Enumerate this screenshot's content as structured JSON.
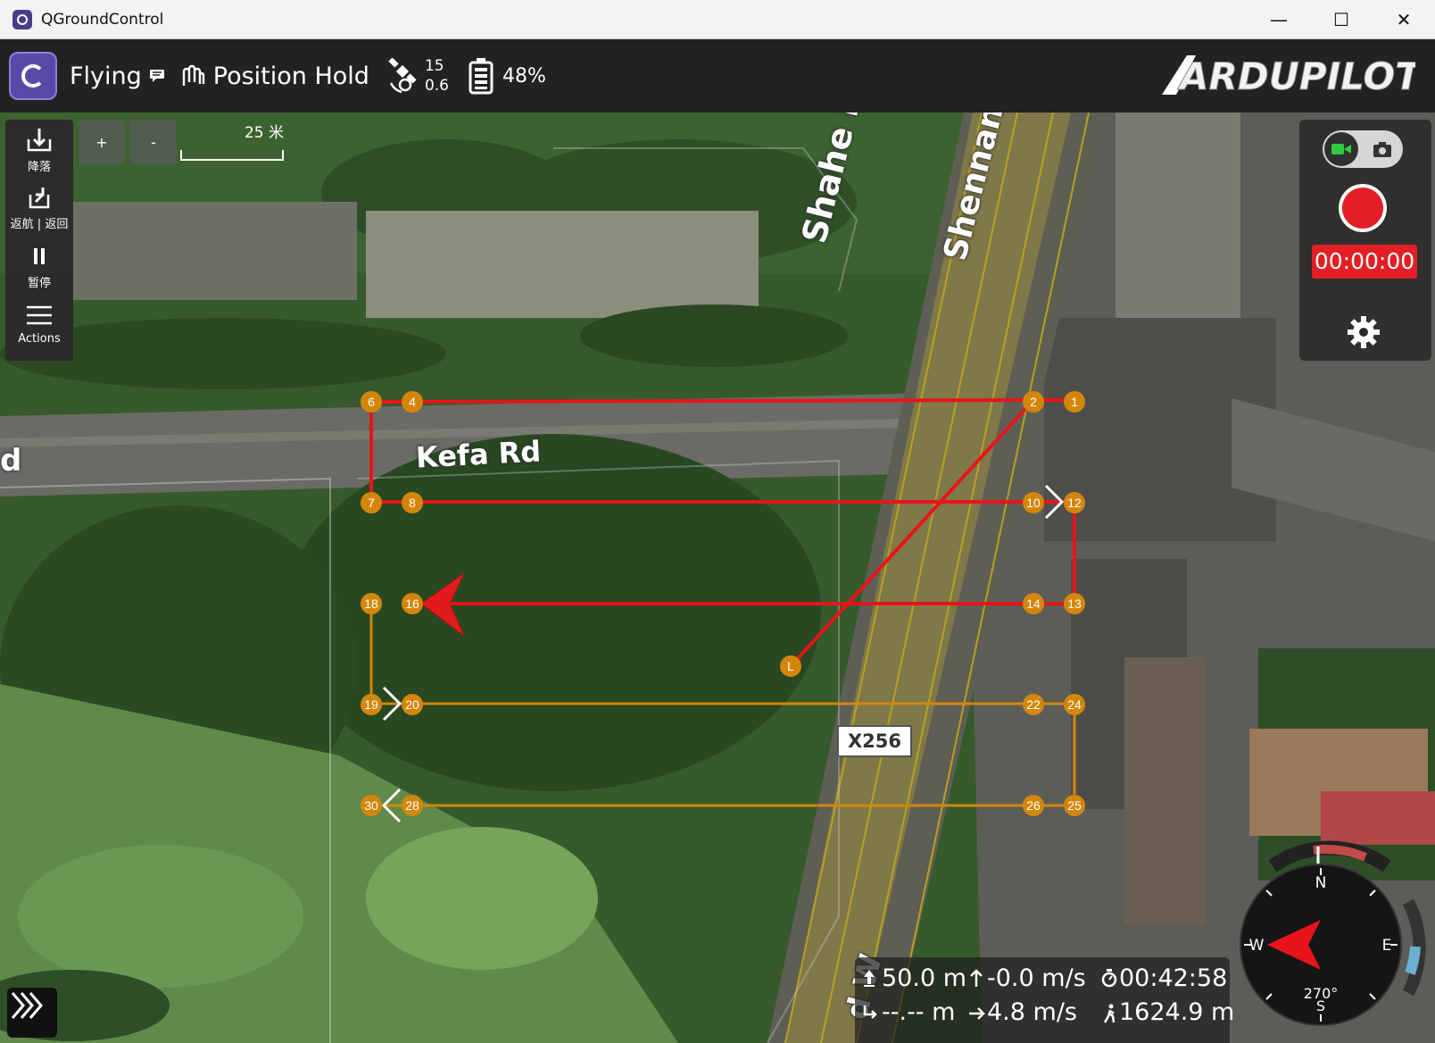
{
  "window": {
    "title": "QGroundControl"
  },
  "toolbar": {
    "flight_state": "Flying",
    "flight_mode": "Position Hold",
    "satellites": "15",
    "hdop": "0.6",
    "battery": "48%",
    "brand": "ARDUPILOT"
  },
  "toolstrip": {
    "land": "降落",
    "rtl": "返航 | 返回",
    "pause": "暂停",
    "actions": "Actions"
  },
  "zoom": {
    "in": "+",
    "out": "-"
  },
  "scale": {
    "label": "25 米"
  },
  "video": {
    "timer": "00:00:00"
  },
  "map_labels": {
    "kefa": "Kefa Rd",
    "shahe": "Shahe Rd W",
    "shennan": "Shennanshahe",
    "left_partial": "d",
    "bottom_partial": "d W",
    "road_sign": "X256"
  },
  "waypoints": [
    "1",
    "2",
    "4",
    "6",
    "7",
    "8",
    "10",
    "12",
    "13",
    "14",
    "16",
    "18",
    "19",
    "20",
    "22",
    "24",
    "25",
    "26",
    "28",
    "30",
    "L"
  ],
  "telemetry": {
    "altitude": "50.0 m",
    "vertical_speed": "-0.0 m/s",
    "flight_time": "00:42:58",
    "distance_to_home": "--.-- m",
    "ground_speed": "4.8 m/s",
    "total_distance": "1624.9 m"
  },
  "compass": {
    "n": "N",
    "e": "E",
    "s": "S",
    "w": "W",
    "heading": "270°"
  },
  "colors": {
    "flown_path": "#e8141a",
    "planned_path": "#d4860b",
    "record": "#e41e25",
    "toolbar": "#222222"
  }
}
